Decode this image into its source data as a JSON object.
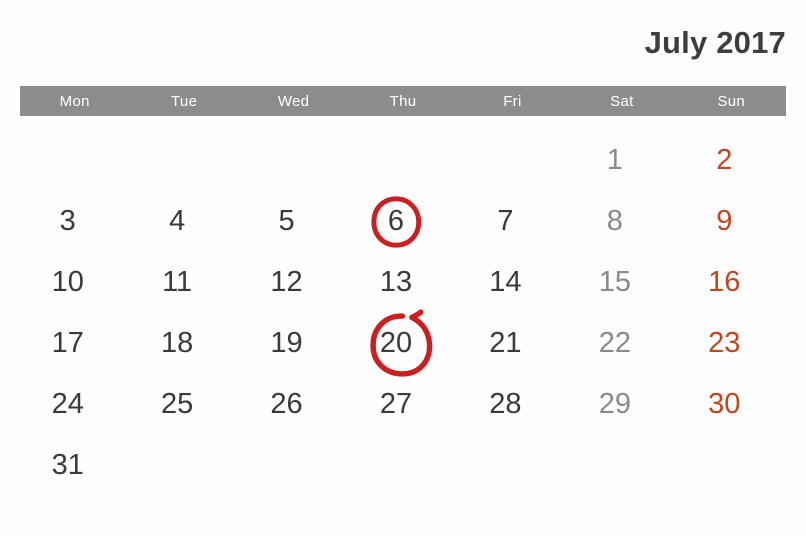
{
  "header": {
    "month_title": "July 2017"
  },
  "weekdays": [
    {
      "label": "Mon",
      "kind": "weekday"
    },
    {
      "label": "Tue",
      "kind": "weekday"
    },
    {
      "label": "Wed",
      "kind": "weekday"
    },
    {
      "label": "Thu",
      "kind": "weekday"
    },
    {
      "label": "Fri",
      "kind": "weekday"
    },
    {
      "label": "Sat",
      "kind": "saturday"
    },
    {
      "label": "Sun",
      "kind": "sunday"
    }
  ],
  "colors": {
    "header_bar": "#8c8c8c",
    "header_text": "#ffffff",
    "title_text": "#3d3d3d",
    "weekday_number": "#3a3a3a",
    "saturday_number": "#8a8a8a",
    "sunday_number": "#c0471f",
    "highlight_ring": "#cc1f22",
    "background": "#fdfdfd"
  },
  "grid": {
    "rows": [
      [
        "",
        "",
        "",
        "",
        "",
        "1",
        "2"
      ],
      [
        "3",
        "4",
        "5",
        "6",
        "7",
        "8",
        "9"
      ],
      [
        "10",
        "11",
        "12",
        "13",
        "14",
        "15",
        "16"
      ],
      [
        "17",
        "18",
        "19",
        "20",
        "21",
        "22",
        "23"
      ],
      [
        "24",
        "25",
        "26",
        "27",
        "28",
        "29",
        "30"
      ],
      [
        "31",
        "",
        "",
        "",
        "",
        "",
        ""
      ]
    ]
  },
  "highlighted_dates": [
    {
      "day": "6",
      "row": 1,
      "col": 3,
      "style": "small"
    },
    {
      "day": "20",
      "row": 3,
      "col": 3,
      "style": "large"
    }
  ]
}
